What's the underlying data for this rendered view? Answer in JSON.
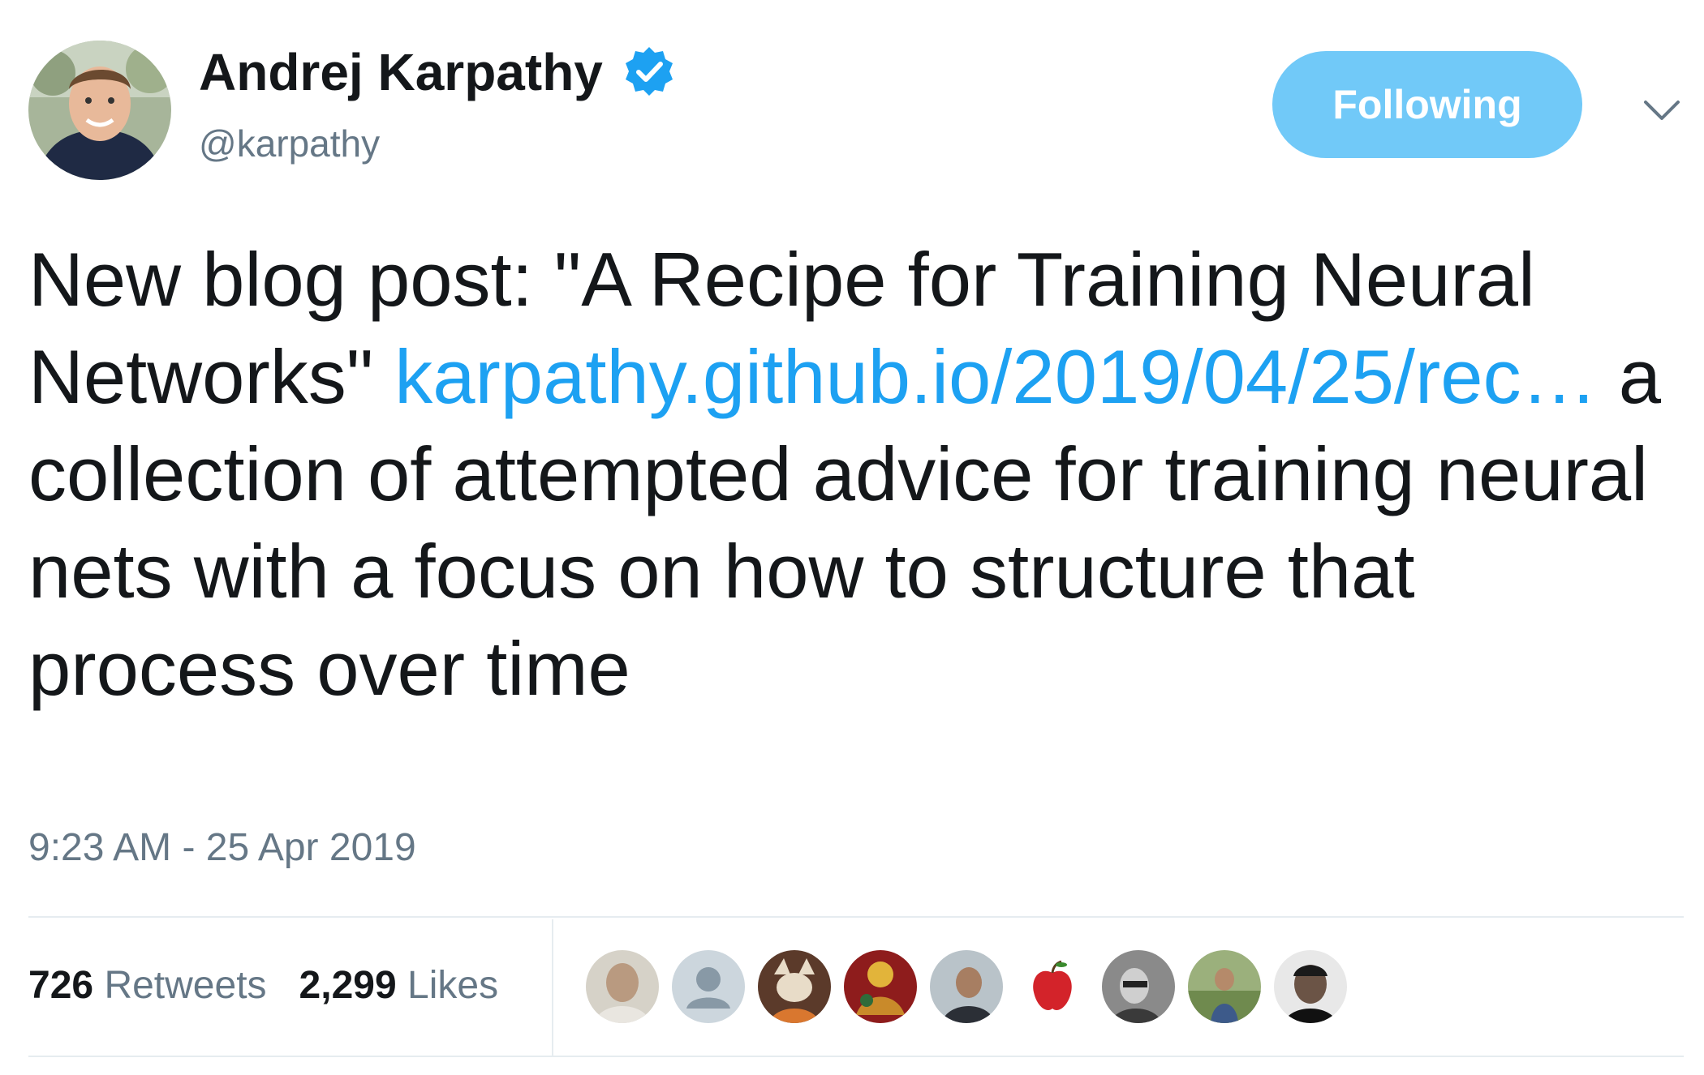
{
  "user": {
    "name": "Andrej Karpathy",
    "handle": "@karpathy",
    "verified": true
  },
  "follow_button": {
    "label": "Following"
  },
  "tweet": {
    "text_before_link": "New blog post: \"A Recipe for Training Neural Networks\" ",
    "link_text": "karpathy.github.io/2019/04/25/rec…",
    "text_after_link": " a collection of attempted advice for training neural nets with a focus on how to structure that process over time",
    "timestamp": "9:23 AM - 25 Apr 2019"
  },
  "stats": {
    "retweets_count": "726",
    "retweets_label": "Retweets",
    "likes_count": "2,299",
    "likes_label": "Likes"
  },
  "likers": [
    "liker-avatar",
    "default-avatar-icon",
    "liker-avatar",
    "liker-avatar",
    "liker-avatar",
    "apple-icon",
    "liker-avatar",
    "liker-avatar",
    "liker-avatar"
  ],
  "colors": {
    "brand_blue": "#1da1f2",
    "follow_button_bg": "#71c9f8",
    "muted_text": "#657786",
    "divider": "#e6ecf0"
  }
}
